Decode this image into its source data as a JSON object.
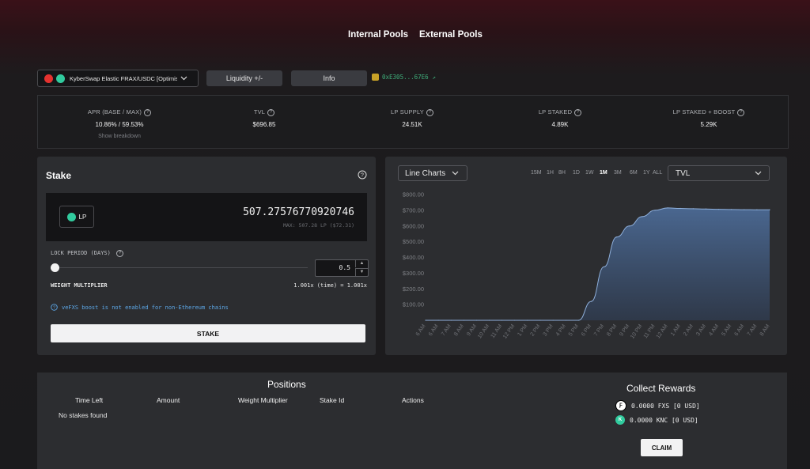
{
  "nav": {
    "internal": "Internal Pools",
    "external": "External Pools"
  },
  "pool": {
    "name": "KyberSwap Elastic FRAX/USDC [Optimism]",
    "liquidity_label": "Liquidity +/-",
    "info_label": "Info",
    "address": "0xE305...67E6 ↗"
  },
  "stats": {
    "apr_label": "APR (BASE / MAX)",
    "apr_value": "10.86% / 59.53%",
    "breakdown": "Show breakdown",
    "tvl_label": "TVL",
    "tvl_value": "$696.85",
    "supply_label": "LP SUPPLY",
    "supply_value": "24.51K",
    "staked_label": "LP STAKED",
    "staked_value": "4.89K",
    "boost_label": "LP STAKED + BOOST",
    "boost_value": "5.29K"
  },
  "stake": {
    "title": "Stake",
    "lp_label": "LP",
    "amount": "507.27576770920746",
    "max_text": "MAX: 507.28 LP ($72.31)",
    "lock_label": "LOCK PERIOD (DAYS)",
    "lock_value": "0.5",
    "lock_fraction": 0.0,
    "weight_label": "WEIGHT MULTIPLIER",
    "weight_value": "1.001x (time) = 1.001x",
    "note": "veFXS boost is not enabled for non-Ethereum chains",
    "stake_button": "STAKE"
  },
  "chart_panel": {
    "chart_type_label": "Line Charts",
    "timeframes": [
      "15M",
      "1H",
      "8H",
      "1D",
      "1W",
      "1M",
      "3M",
      "6M",
      "1Y",
      "ALL"
    ],
    "active_timeframe": "1M",
    "metric_label": "TVL",
    "area_color": "#4a6790"
  },
  "chart_data": {
    "type": "area",
    "title": "",
    "xlabel": "",
    "ylabel": "",
    "ylim": [
      0,
      800
    ],
    "yticks": [
      "$100.00",
      "$200.00",
      "$300.00",
      "$400.00",
      "$500.00",
      "$600.00",
      "$700.00",
      "$800.00"
    ],
    "categories": [
      "6 AM",
      "6 AM",
      "7 AM",
      "8 AM",
      "9 AM",
      "10 AM",
      "11 AM",
      "12 PM",
      "1 PM",
      "2 PM",
      "3 PM",
      "4 PM",
      "5 PM",
      "6 PM",
      "7 PM",
      "8 PM",
      "9 PM",
      "10 PM",
      "11 PM",
      "12 AM",
      "1 AM",
      "2 AM",
      "3 AM",
      "4 AM",
      "5 AM",
      "6 AM",
      "7 AM",
      "8 AM"
    ],
    "values": [
      0,
      0,
      0,
      0,
      0,
      0,
      0,
      0,
      0,
      0,
      0,
      0,
      0,
      120,
      340,
      530,
      600,
      660,
      700,
      715,
      712,
      710,
      708,
      706,
      705,
      704,
      703,
      703
    ]
  },
  "positions": {
    "title": "Positions",
    "columns": [
      "Time Left",
      "Amount",
      "Weight Multiplier",
      "Stake Id",
      "Actions"
    ],
    "empty_text": "No stakes found"
  },
  "rewards": {
    "title": "Collect Rewards",
    "items": [
      {
        "icon": "fxs-token-icon",
        "text": "0.0000 FXS [0 USD]"
      },
      {
        "icon": "knc-token-icon",
        "text": "0.0000 KNC [0 USD]"
      }
    ],
    "claim_label": "CLAIM"
  }
}
